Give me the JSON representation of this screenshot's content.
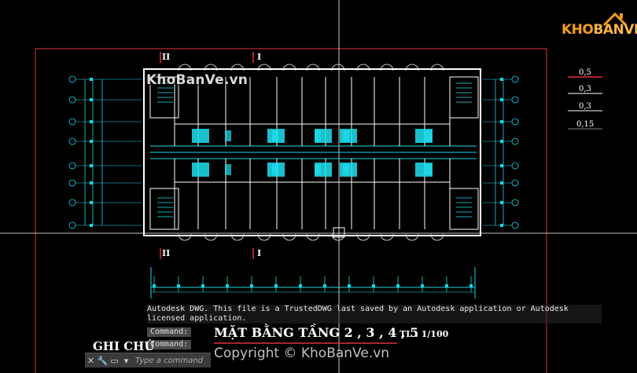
{
  "app": {
    "command_history": "Autodesk DWG.  This file is a TrustedDWG last saved by an Autodesk application or Autodesk licensed application.",
    "command_label_1": "Command:",
    "command_label_2": "Command:",
    "command_prompt": "Type a command"
  },
  "drawing": {
    "title": "MẶT BẰNG TẦNG 2 , 3 , 4 , 5",
    "scale": "TL : 1/100",
    "notes_heading": "GHI CHÚ",
    "section_marks": [
      "II",
      "I",
      "II",
      "I"
    ],
    "lineweights": [
      "0,5",
      "0,3",
      "0,3",
      "0,15"
    ]
  },
  "watermark": {
    "top": "KhoBanVe.vn",
    "bottom": "Copyright © KhoBanVe.vn",
    "logo_a": "KHO",
    "logo_b": "BANVE"
  },
  "colors": {
    "frame": "#e0303a",
    "wall": "#ffffff",
    "grid": "#19d6e6",
    "fixture": "#1ee0f0",
    "crosshair": "#ffffff"
  }
}
